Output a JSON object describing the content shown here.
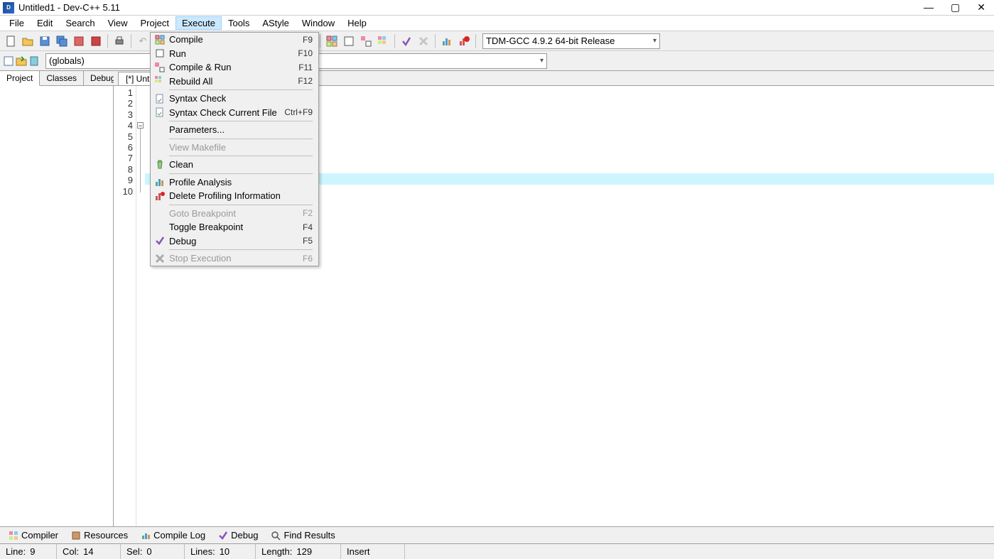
{
  "window": {
    "title": "Untitled1 - Dev-C++ 5.11"
  },
  "menubar": [
    "File",
    "Edit",
    "Search",
    "View",
    "Project",
    "Execute",
    "Tools",
    "AStyle",
    "Window",
    "Help"
  ],
  "menubar_active": 5,
  "compiler_select": "TDM-GCC 4.9.2 64-bit Release",
  "globals_combo": "(globals)",
  "left_tabs": [
    "Project",
    "Classes",
    "Debug"
  ],
  "editor_tab": "[*] Unt",
  "line_count": 10,
  "execute_menu": [
    {
      "label": "Compile",
      "short": "F9",
      "icon": "grid",
      "enabled": true
    },
    {
      "label": "Run",
      "short": "F10",
      "icon": "run",
      "enabled": true
    },
    {
      "label": "Compile & Run",
      "short": "F11",
      "icon": "compilerun",
      "enabled": true
    },
    {
      "label": "Rebuild All",
      "short": "F12",
      "icon": "rebuild",
      "enabled": true
    },
    {
      "sep": true
    },
    {
      "label": "Syntax Check",
      "short": "",
      "icon": "syntax",
      "enabled": true
    },
    {
      "label": "Syntax Check Current File",
      "short": "Ctrl+F9",
      "icon": "syntaxfile",
      "enabled": true
    },
    {
      "sep": true
    },
    {
      "label": "Parameters...",
      "short": "",
      "icon": "",
      "enabled": true
    },
    {
      "sep": true
    },
    {
      "label": "View Makefile",
      "short": "",
      "icon": "",
      "enabled": false
    },
    {
      "sep": true
    },
    {
      "label": "Clean",
      "short": "",
      "icon": "clean",
      "enabled": true
    },
    {
      "sep": true
    },
    {
      "label": "Profile Analysis",
      "short": "",
      "icon": "profile",
      "enabled": true
    },
    {
      "label": "Delete Profiling Information",
      "short": "",
      "icon": "delprof",
      "enabled": true
    },
    {
      "sep": true
    },
    {
      "label": "Goto Breakpoint",
      "short": "F2",
      "icon": "",
      "enabled": false
    },
    {
      "label": "Toggle Breakpoint",
      "short": "F4",
      "icon": "",
      "enabled": true
    },
    {
      "label": "Debug",
      "short": "F5",
      "icon": "debug",
      "enabled": true
    },
    {
      "sep": true
    },
    {
      "label": "Stop Execution",
      "short": "F6",
      "icon": "stop",
      "enabled": false
    }
  ],
  "bottom_tabs": [
    "Compiler",
    "Resources",
    "Compile Log",
    "Debug",
    "Find Results"
  ],
  "status": {
    "line_lbl": "Line:",
    "line": "9",
    "col_lbl": "Col:",
    "col": "14",
    "sel_lbl": "Sel:",
    "sel": "0",
    "lines_lbl": "Lines:",
    "lines": "10",
    "len_lbl": "Length:",
    "len": "129",
    "mode": "Insert"
  }
}
